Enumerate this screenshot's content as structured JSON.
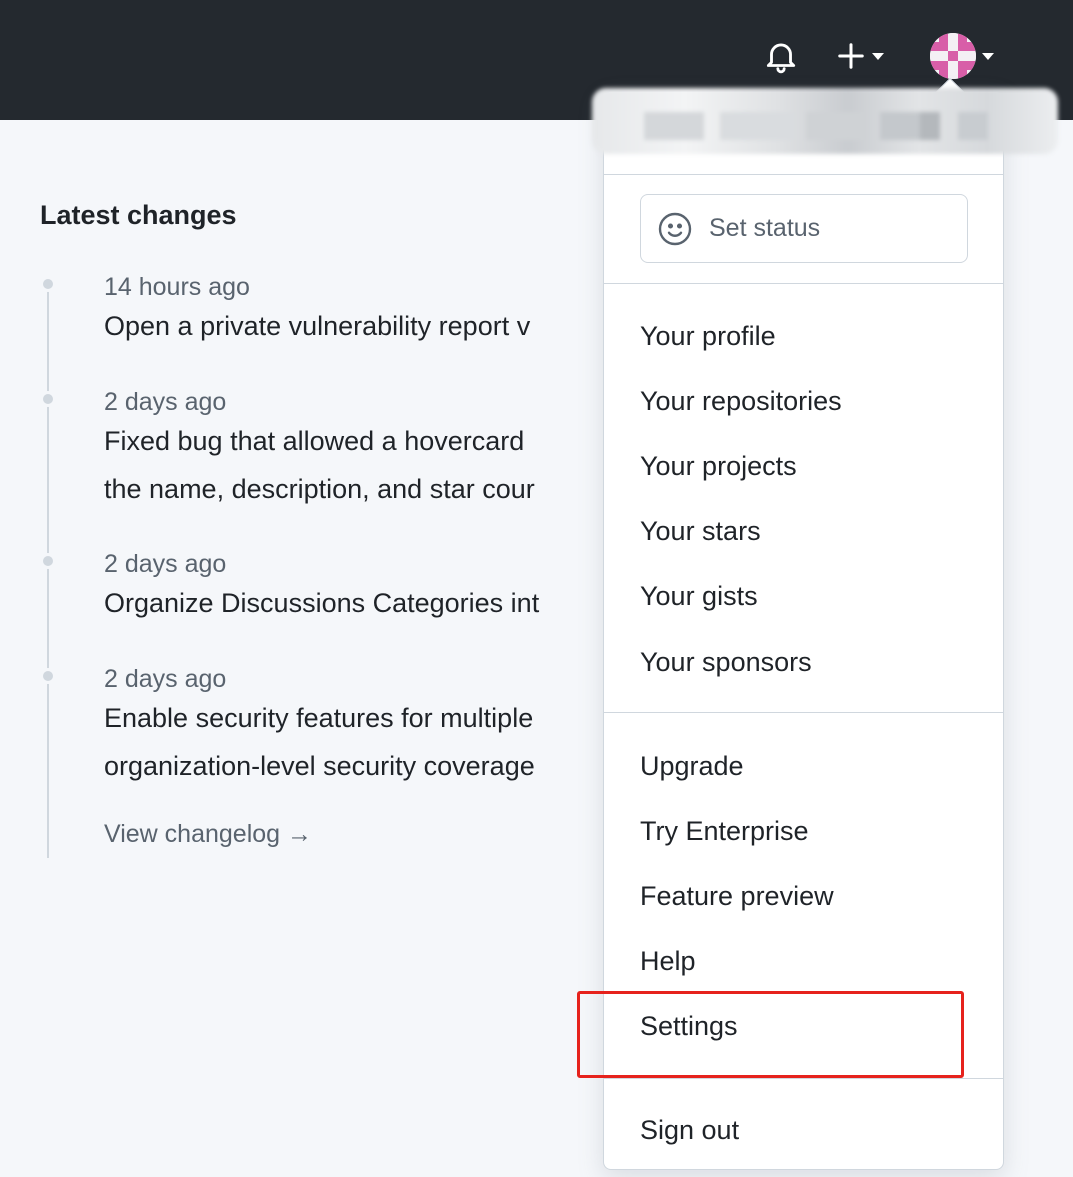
{
  "header": {
    "notifications_icon": "bell-icon",
    "create_icon": "plus-icon",
    "avatar_icon": "identicon-avatar",
    "background_color": "#24292f"
  },
  "changes": {
    "title": "Latest changes",
    "entries": [
      {
        "when": "14 hours ago",
        "lines": [
          "Open a private vulnerability report v"
        ]
      },
      {
        "when": "2 days ago",
        "lines": [
          "Fixed bug that allowed a hovercard",
          "the name, description, and star cour"
        ]
      },
      {
        "when": "2 days ago",
        "lines": [
          "Organize Discussions Categories int"
        ]
      },
      {
        "when": "2 days ago",
        "lines": [
          "Enable security features for multiple",
          "organization-level security coverage"
        ]
      }
    ],
    "view_changelog": "View changelog →"
  },
  "menu": {
    "set_status": "Set status",
    "set_status_icon": "smiley-icon",
    "group1": [
      "Your profile",
      "Your repositories",
      "Your projects",
      "Your stars",
      "Your gists",
      "Your sponsors"
    ],
    "group2": [
      "Upgrade",
      "Try Enterprise",
      "Feature preview",
      "Help",
      "Settings"
    ],
    "sign_out": "Sign out",
    "highlighted_item": "Settings",
    "highlight_color": "#e6221c"
  }
}
